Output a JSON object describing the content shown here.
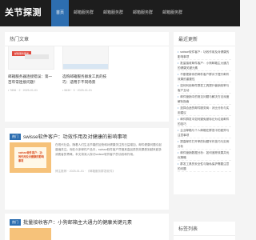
{
  "header": {
    "logo": "关节探测",
    "nav": [
      "首页",
      "邮箱服务群",
      "邮箱服务群",
      "邮箱服务群",
      "邮箱服务群",
      "邮箱服务群"
    ]
  },
  "hot": {
    "heading": "热门文章",
    "cards": [
      {
        "tag": "邮箱服务群发",
        "title": "邮箱服务器连接错误：第一百年常连接问题！",
        "meta": "• 7896 · 2 · 2025-01-01"
      },
      {
        "tag": "",
        "title": "选购邮箱服务群发工具的技巧：适用于不同场景",
        "meta": "• 5630 · 3 · 2025-01-01"
      }
    ]
  },
  "posts": [
    {
      "badge": "热门",
      "title": "swisse软件客户：功效作用及对健康的影响事项",
      "thumb_text": "swisse软件客户：功效作用及对健康的影响事项",
      "body": "在现代社会，随着人们生活节奏的加快和对健康关注的日益增加，邮件健康问题引起普遍关注。而在众多邮件产品中，swisse软件客户凭借其高品质的效果受到越来越多消费者的青睐。本文将深入探讨swisse软件客户的功效和作用。",
      "meta": "博主推荐 · 2025-01-01 · 《邮箱服务群发软件》"
    },
    {
      "badge": "热门",
      "title": "批量接收客户：小狗邮箱主大通力的健康关键元素"
    }
  ],
  "sidebar": {
    "heading": "最近更新",
    "items": [
      "swisse软件客户：功效作用及对健康的影响事项",
      "批量接收邮件客户：小狗邮箱主大通力的健康关键元素",
      "不断更新你的邮件客户群对于提升邮件效果的重要性",
      "如何利用邮件群发工具提升营销效率与客户互动",
      "邮件营销中的常见问题与解决方法深度解析指南",
      "选择合适的邮件服务商：对比分析与实用建议",
      "邮件群发中如何避免被标记为垃圾邮件的技巧",
      "企业邮箱与个人邮箱在群发中的差异与注意事项",
      "提高邮件打开率的标题写作技巧与实例分析",
      "邮件营销数据分析：如何追踪效果并优化策略",
      "群发工具的安全性与隐私保护需要注意的问题"
    ],
    "bottom_heading": "标签列表"
  }
}
